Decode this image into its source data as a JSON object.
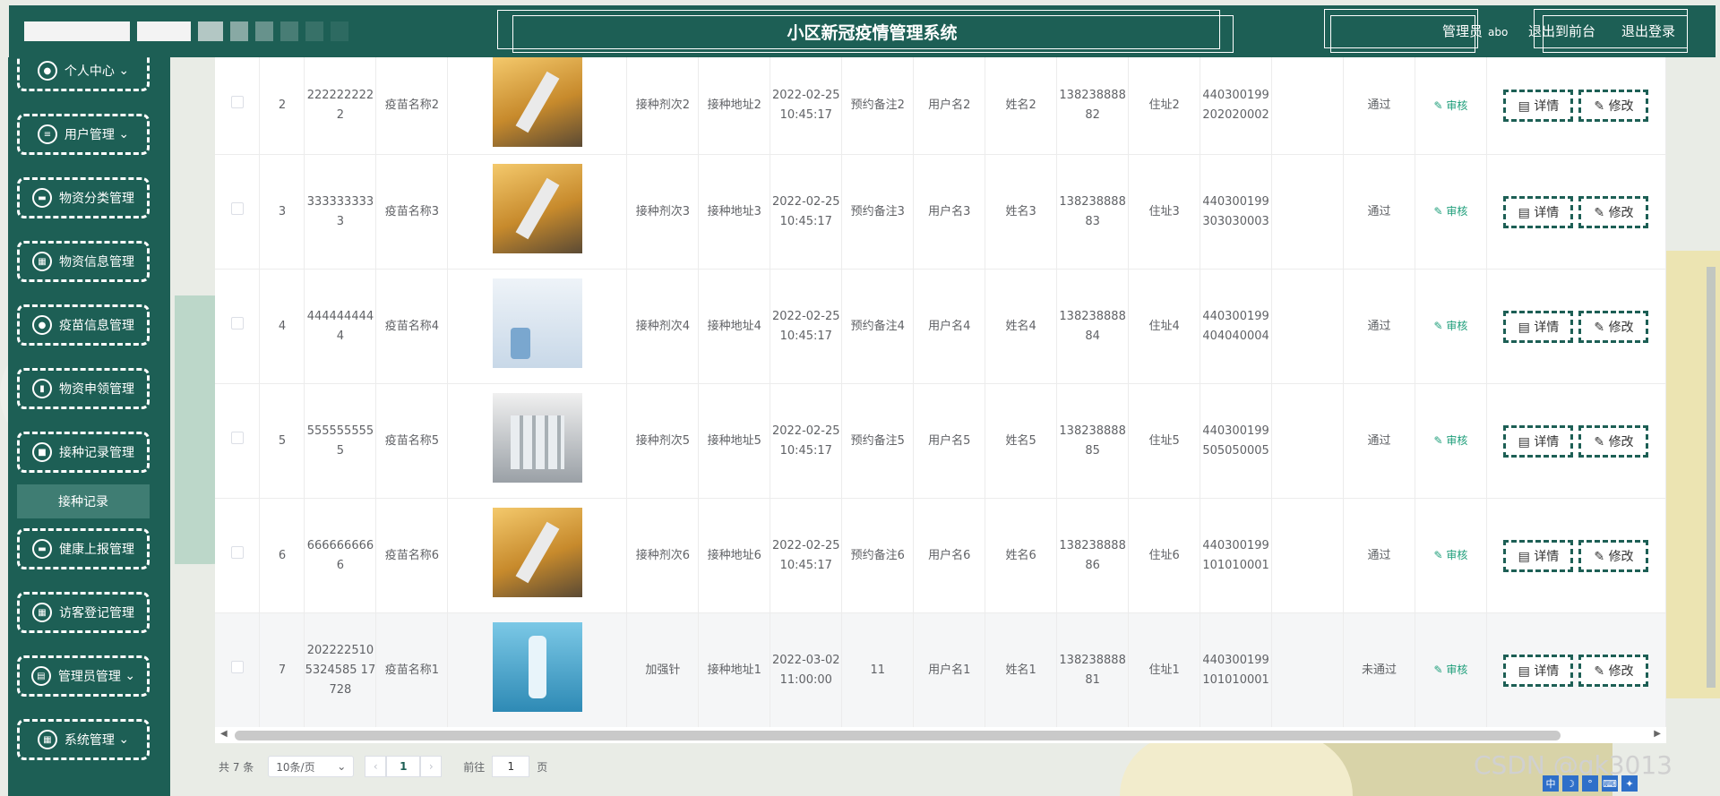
{
  "header": {
    "title": "小区新冠疫情管理系统",
    "role_label": "管理员",
    "username": "abo",
    "nav_front": "退出到前台",
    "nav_logout": "退出登录"
  },
  "sidebar": {
    "items": [
      {
        "label": "个人中心",
        "icon": "person-icon"
      },
      {
        "label": "用户管理",
        "icon": "list-icon"
      },
      {
        "label": "物资分类管理",
        "icon": "monitor-icon"
      },
      {
        "label": "物资信息管理",
        "icon": "grid-icon"
      },
      {
        "label": "疫苗信息管理",
        "icon": "location-pin-icon"
      },
      {
        "label": "物资申领管理",
        "icon": "chart-icon"
      },
      {
        "label": "接种记录管理",
        "icon": "camera-icon"
      },
      {
        "label": "健康上报管理",
        "icon": "chat-icon"
      },
      {
        "label": "访客登记管理",
        "icon": "grid-icon"
      },
      {
        "label": "管理员管理",
        "icon": "clipboard-icon"
      },
      {
        "label": "系统管理",
        "icon": "grid-icon"
      }
    ],
    "active_submenu": "接种记录"
  },
  "table": {
    "rows": [
      {
        "idx": "2",
        "vaccine_no": "2222222222",
        "vaccine_name": "疫苗名称2",
        "image": "orange",
        "dose": "接种剂次2",
        "site": "接种地址2",
        "time": "2022-02-25 10:45:17",
        "note": "预约备注2",
        "user": "用户名2",
        "name": "姓名2",
        "phone": "13823888882",
        "address": "住址2",
        "id_no": "440300199202020002",
        "status": "通过"
      },
      {
        "idx": "3",
        "vaccine_no": "3333333333",
        "vaccine_name": "疫苗名称3",
        "image": "orange",
        "dose": "接种剂次3",
        "site": "接种地址3",
        "time": "2022-02-25 10:45:17",
        "note": "预约备注3",
        "user": "用户名3",
        "name": "姓名3",
        "phone": "13823888883",
        "address": "住址3",
        "id_no": "440300199303030003",
        "status": "通过"
      },
      {
        "idx": "4",
        "vaccine_no": "4444444444",
        "vaccine_name": "疫苗名称4",
        "image": "blue",
        "dose": "接种剂次4",
        "site": "接种地址4",
        "time": "2022-02-25 10:45:17",
        "note": "预约备注4",
        "user": "用户名4",
        "name": "姓名4",
        "phone": "13823888884",
        "address": "住址4",
        "id_no": "440300199404040004",
        "status": "通过"
      },
      {
        "idx": "5",
        "vaccine_no": "5555555555",
        "vaccine_name": "疫苗名称5",
        "image": "silver",
        "dose": "接种剂次5",
        "site": "接种地址5",
        "time": "2022-02-25 10:45:17",
        "note": "预约备注5",
        "user": "用户名5",
        "name": "姓名5",
        "phone": "13823888885",
        "address": "住址5",
        "id_no": "440300199505050005",
        "status": "通过"
      },
      {
        "idx": "6",
        "vaccine_no": "6666666666",
        "vaccine_name": "疫苗名称6",
        "image": "orange",
        "dose": "接种剂次6",
        "site": "接种地址6",
        "time": "2022-02-25 10:45:17",
        "note": "预约备注6",
        "user": "用户名6",
        "name": "姓名6",
        "phone": "13823888886",
        "address": "住址6",
        "id_no": "440300199101010001",
        "status": "通过"
      },
      {
        "idx": "7",
        "vaccine_no": "2022225105324585 17728",
        "vaccine_name": "疫苗名称1",
        "image": "cyan",
        "dose": "加强针",
        "site": "接种地址1",
        "time": "2022-03-02 11:00:00",
        "note": "11",
        "user": "用户名1",
        "name": "姓名1",
        "phone": "13823888881",
        "address": "住址1",
        "id_no": "440300199101010001",
        "status": "未通过"
      }
    ],
    "audit_label": "审核",
    "detail_label": "详情",
    "edit_label": "修改"
  },
  "pagination": {
    "total": "共 7 条",
    "page_size": "10条/页",
    "current_page": "1",
    "goto_prefix": "前往",
    "goto_value": "1",
    "goto_suffix": "页"
  },
  "watermark": "CSDN @qk3013",
  "tray": [
    "中",
    "☽",
    "°",
    "⌨",
    "✦"
  ]
}
